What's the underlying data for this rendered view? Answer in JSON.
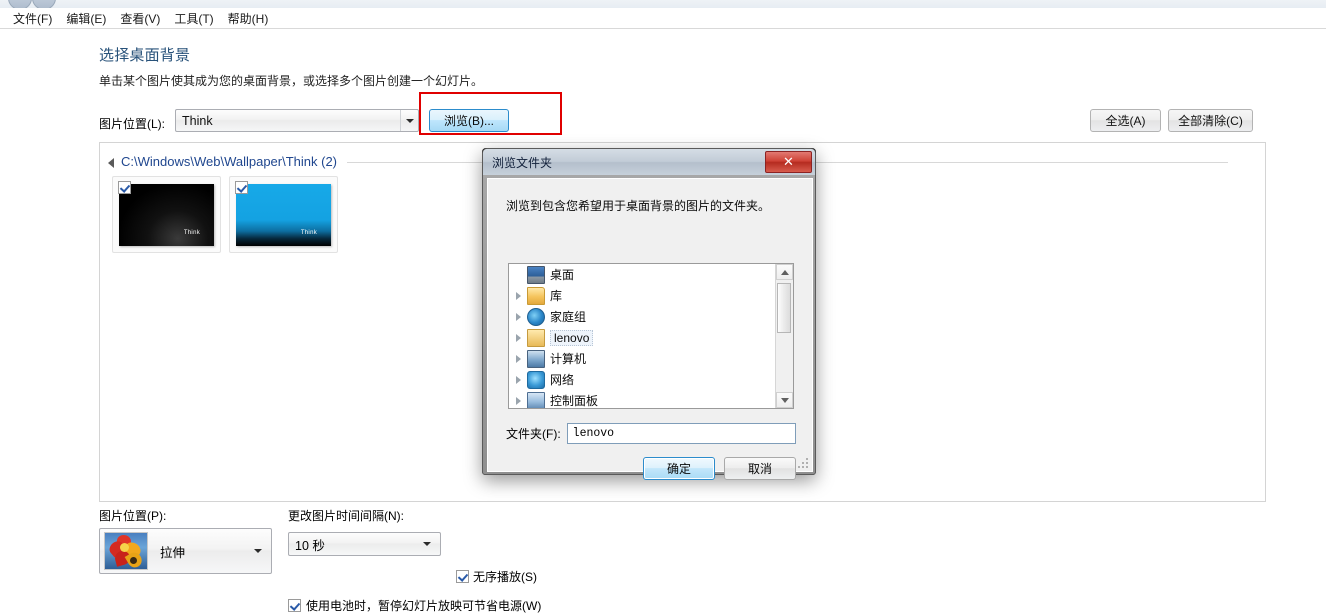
{
  "menubar": {
    "items": [
      {
        "label": "文件(F)",
        "name": "menu-file"
      },
      {
        "label": "编辑(E)",
        "name": "menu-edit"
      },
      {
        "label": "查看(V)",
        "name": "menu-view"
      },
      {
        "label": "工具(T)",
        "name": "menu-tools"
      },
      {
        "label": "帮助(H)",
        "name": "menu-help"
      }
    ]
  },
  "page": {
    "title": "选择桌面背景",
    "description": "单击某个图片使其成为您的桌面背景，或选择多个图片创建一个幻灯片。"
  },
  "location": {
    "label": "图片位置(L):",
    "value": "Think",
    "browse_button": "浏览(B)...",
    "select_all_button": "全选(A)",
    "clear_all_button": "全部清除(C)",
    "highlight_color": "#e00000"
  },
  "wallpaper_group": {
    "path": "C:\\Windows\\Web\\Wallpaper\\Think (2)",
    "count": 2,
    "thumbnails": [
      {
        "name": "wallpaper-think-black",
        "brand": "Think",
        "checked": true,
        "style": "black"
      },
      {
        "name": "wallpaper-think-blue",
        "brand": "Think",
        "checked": true,
        "style": "blue"
      }
    ]
  },
  "bottom": {
    "position_label": "图片位置(P):",
    "position_value": "拉伸",
    "interval_label": "更改图片时间间隔(N):",
    "interval_value": "10 秒",
    "shuffle_label": "无序播放(S)",
    "shuffle_checked": true,
    "battery_label": "使用电池时，暂停幻灯片放映可节省电源(W)",
    "battery_checked": true
  },
  "dialog": {
    "title": "浏览文件夹",
    "close_label": "✕",
    "instruction": "浏览到包含您希望用于桌面背景的图片的文件夹。",
    "tree": [
      {
        "label": "桌面",
        "icon": "monitor-icon",
        "expandable": false,
        "selected": false,
        "name": "tree-item-desktop"
      },
      {
        "label": "库",
        "icon": "folder-icon",
        "expandable": true,
        "selected": false,
        "name": "tree-item-libraries"
      },
      {
        "label": "家庭组",
        "icon": "homegroup-icon",
        "expandable": true,
        "selected": false,
        "name": "tree-item-homegroup"
      },
      {
        "label": "lenovo",
        "icon": "user-icon",
        "expandable": true,
        "selected": true,
        "name": "tree-item-lenovo"
      },
      {
        "label": "计算机",
        "icon": "computer-icon",
        "expandable": true,
        "selected": false,
        "name": "tree-item-computer"
      },
      {
        "label": "网络",
        "icon": "network-icon",
        "expandable": true,
        "selected": false,
        "name": "tree-item-network"
      },
      {
        "label": "控制面板",
        "icon": "control-panel-icon",
        "expandable": true,
        "selected": false,
        "name": "tree-item-control-panel"
      }
    ],
    "folder_label": "文件夹(F):",
    "folder_value": "lenovo",
    "ok_button": "确定",
    "cancel_button": "取消"
  }
}
